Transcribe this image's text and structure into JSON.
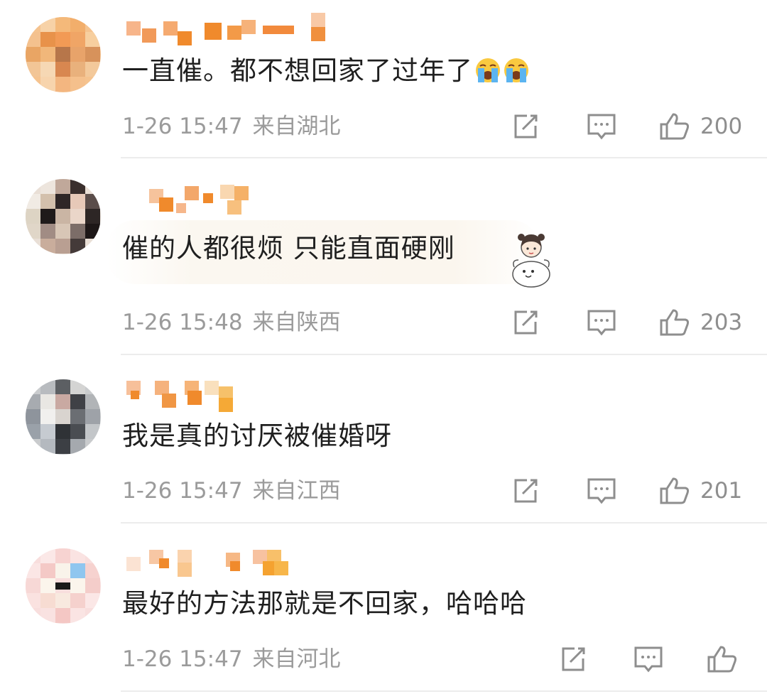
{
  "comments": [
    {
      "text": "一直催。都不想回家了过年了",
      "emoji": [
        "crying-face-icon",
        "crying-face-icon"
      ],
      "date": "1-26 15:47",
      "location": "来自湖北",
      "likes": "200"
    },
    {
      "text": "催的人都很烦 只能直面硬刚",
      "sticker": "girl-and-dog-sticker",
      "date": "1-26 15:48",
      "location": "来自陕西",
      "likes": "203"
    },
    {
      "text": "我是真的讨厌被催婚呀",
      "date": "1-26 15:47",
      "location": "来自江西",
      "likes": "201"
    },
    {
      "text": "最好的方法那就是不回家，哈哈哈",
      "date": "1-26 15:47",
      "location": "来自河北",
      "likes": ""
    }
  ],
  "colors": {
    "meta_text": "#9b9b9b",
    "comment_text": "#1f1f1f",
    "divider": "#ececec",
    "username_pixel": "#f08a2c"
  },
  "icons": {
    "repost": "share-box-icon",
    "comment": "comment-bubble-icon",
    "like": "thumbs-up-icon"
  }
}
